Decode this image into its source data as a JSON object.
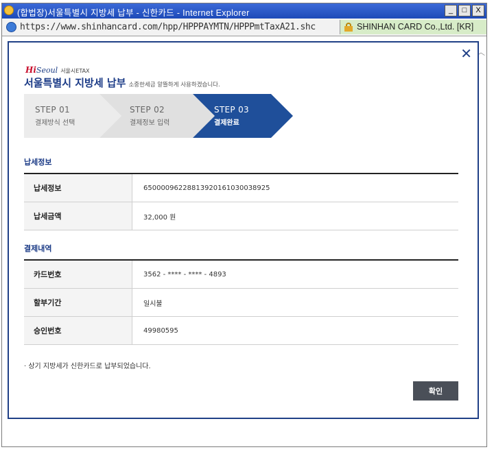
{
  "window": {
    "title": "(합법장)서울특별시 지방세 납부 - 신한카드 - Internet Explorer",
    "buttons": {
      "minimize": "_",
      "maximize": "□",
      "close": "X"
    }
  },
  "addressbar": {
    "url": "https://www.shinhancard.com/hpp/HPPPAYMTN/HPPPmtTaxA21.shc",
    "certificate": "SHINHAN CARD Co.,Ltd. [KR]"
  },
  "dialog": {
    "close_symbol": "✕",
    "logo": {
      "hi": "Hi",
      "seoul": "Seoul",
      "etax": "서울시ETAX"
    },
    "title": "서울특별시 지방세 납부",
    "subtitle": "소중한세금 알뜰하게 사용하겠습니다.",
    "steps": [
      {
        "num": "STEP 01",
        "label": "결제방식 선택",
        "active": false
      },
      {
        "num": "STEP 02",
        "label": "결제정보 입력",
        "active": false
      },
      {
        "num": "STEP 03",
        "label": "결제완료",
        "active": true
      }
    ],
    "tax_section": {
      "title": "납세정보",
      "rows": [
        {
          "label": "납세정보",
          "value": "65000096228813920161030038925"
        },
        {
          "label": "납세금액",
          "value": "32,000 원"
        }
      ]
    },
    "payment_section": {
      "title": "결제내역",
      "rows": [
        {
          "label": "카드번호",
          "value": "3562 - **** - **** - 4893"
        },
        {
          "label": "할부기간",
          "value": "일시불"
        },
        {
          "label": "승인번호",
          "value": "49980595"
        }
      ]
    },
    "note": "· 상기 지방세가 신한카드로 납부되었습니다.",
    "confirm_label": "확인"
  },
  "colors": {
    "accent": "#1f3f86",
    "step_active": "#1f4f9a",
    "step_inactive": "#ececec",
    "button": "#4a4f58"
  }
}
